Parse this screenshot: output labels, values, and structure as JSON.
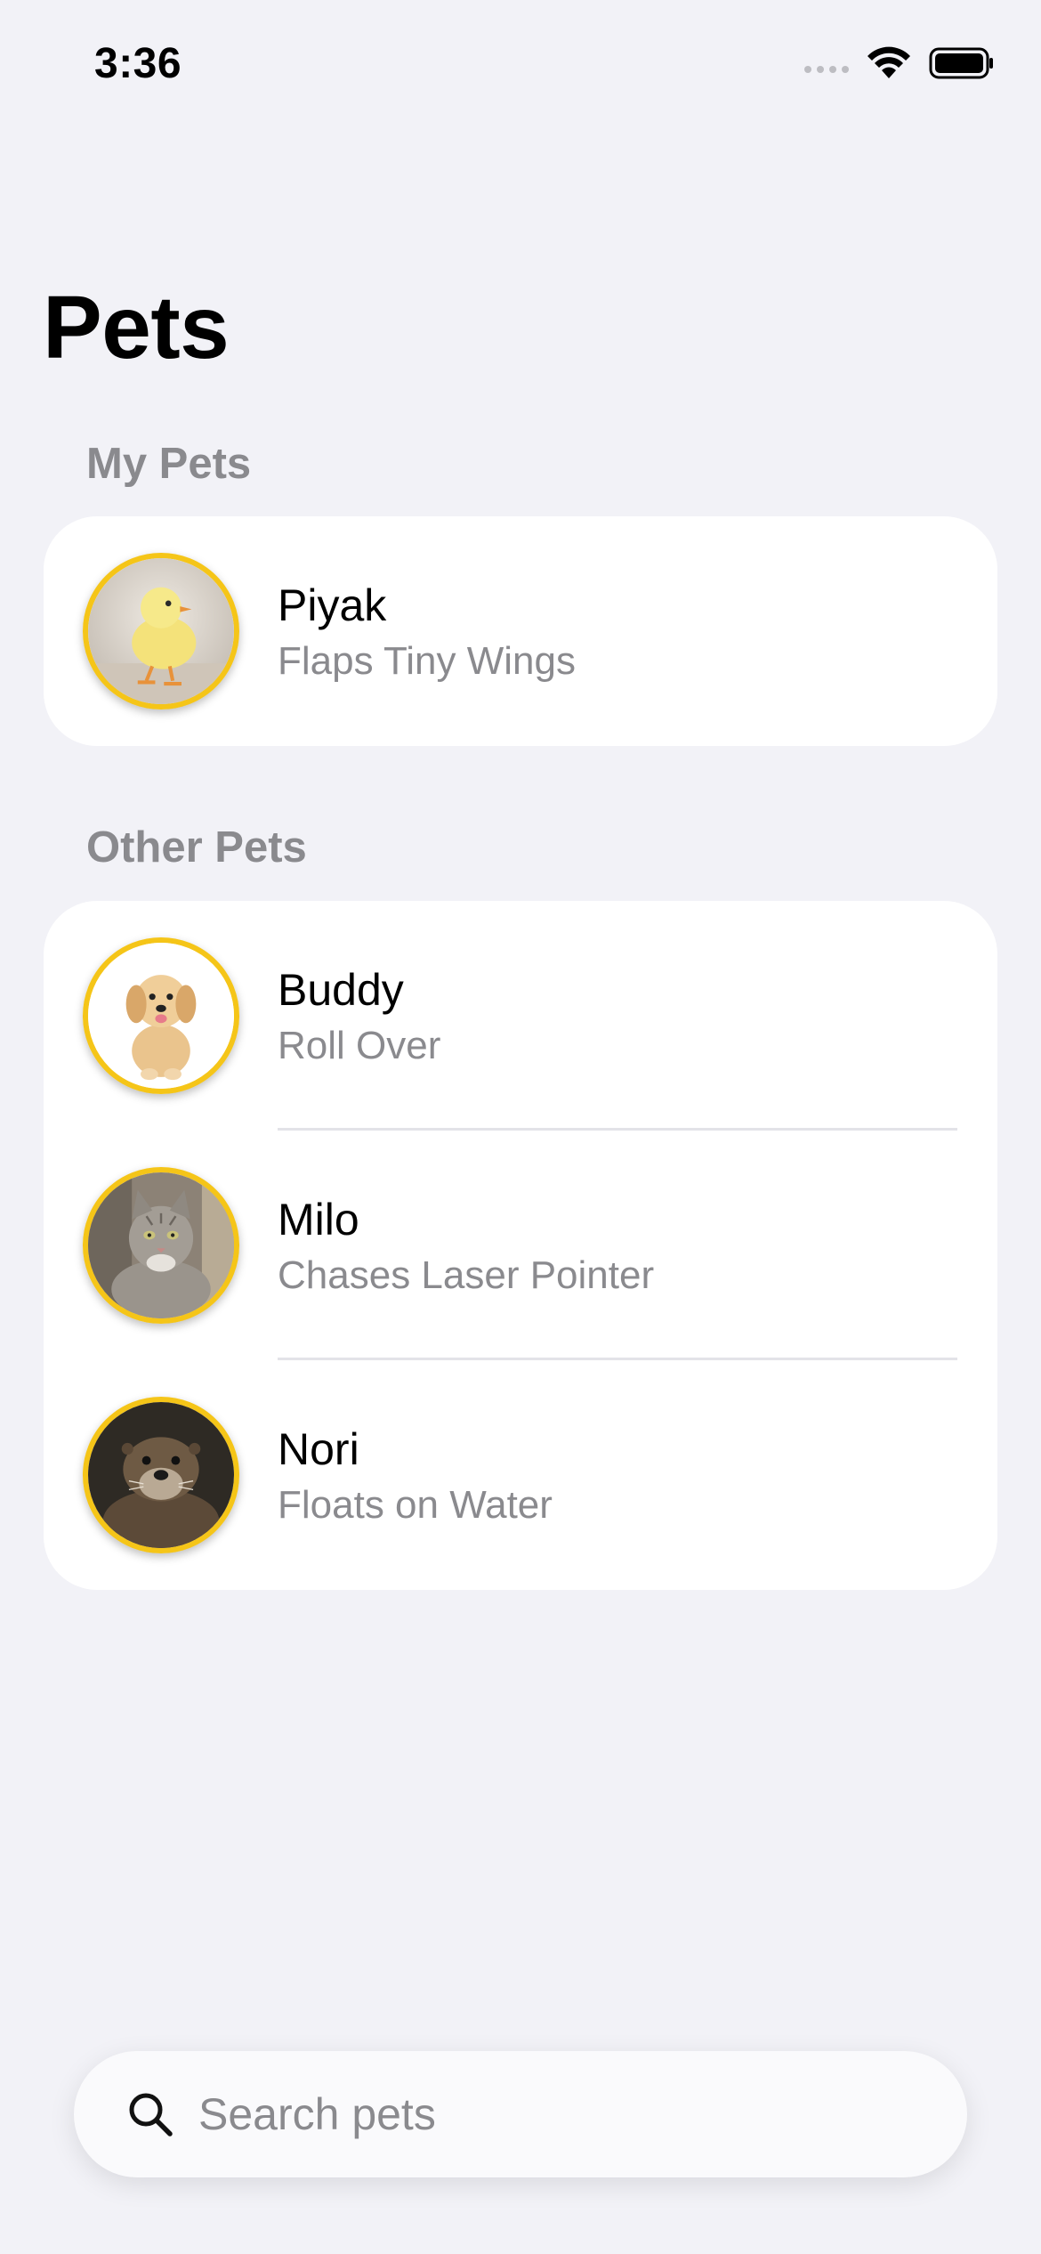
{
  "status_bar": {
    "time": "3:36"
  },
  "title": "Pets",
  "sections": {
    "my_pets": {
      "header": "My Pets",
      "pets": [
        {
          "name": "Piyak",
          "trick": "Flaps Tiny Wings",
          "avatar_icon": "chick-photo"
        }
      ]
    },
    "other_pets": {
      "header": "Other Pets",
      "pets": [
        {
          "name": "Buddy",
          "trick": "Roll Over",
          "avatar_icon": "puppy-photo"
        },
        {
          "name": "Milo",
          "trick": "Chases Laser Pointer",
          "avatar_icon": "cat-photo"
        },
        {
          "name": "Nori",
          "trick": "Floats on Water",
          "avatar_icon": "otter-photo"
        }
      ]
    }
  },
  "search": {
    "placeholder": "Search pets",
    "value": "",
    "icon": "search-icon"
  },
  "colors": {
    "background": "#F2F2F7",
    "card": "#FFFFFF",
    "avatar_ring": "#F5C518",
    "secondary_text": "#8A8A8E"
  }
}
